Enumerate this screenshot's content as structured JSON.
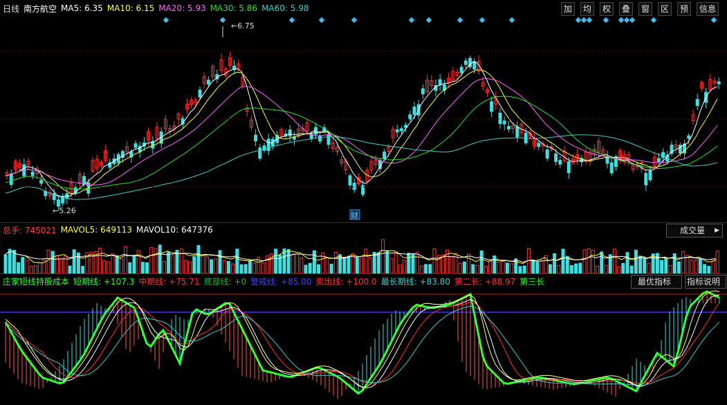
{
  "header": {
    "period": "日线",
    "stock_name": "南方航空",
    "ma": [
      {
        "label": "MA5: 6.35",
        "color": "#ffffff"
      },
      {
        "label": "MA10: 6.15",
        "color": "#ffff44"
      },
      {
        "label": "MA20: 5.93",
        "color": "#ff66ff"
      },
      {
        "label": "MA30: 5.86",
        "color": "#33dd33"
      },
      {
        "label": "MA60: 5.98",
        "color": "#44cccc"
      }
    ],
    "tools": [
      "加",
      "均",
      "权",
      "叠",
      "窗",
      "区",
      "预",
      "信息"
    ]
  },
  "price_chart": {
    "high_label": "6.75",
    "low_label": "5.26",
    "fin_marker": "财"
  },
  "volume": {
    "total": {
      "label": "总手: 745021",
      "color": "#ff4444"
    },
    "mavol5": {
      "label": "MAVOL5: 649113",
      "color": "#ffff44"
    },
    "mavol10": {
      "label": "MAVOL10: 647376",
      "color": "#ffffff"
    },
    "button": "成交量"
  },
  "indicator": {
    "name": {
      "label": "庄家短线持股成本",
      "color": "#33ff33"
    },
    "lines": [
      {
        "label": "短期线: +107.3",
        "color": "#33ff33"
      },
      {
        "label": "中期线: +75.71",
        "color": "#ff3333"
      },
      {
        "label": "底部线: +0",
        "color": "#33aa33"
      },
      {
        "label": "警戒线: +85.00",
        "color": "#4444ff"
      },
      {
        "label": "卖出线: +100.0",
        "color": "#ff3333"
      },
      {
        "label": "最长期线: +83.80",
        "color": "#44cccc"
      },
      {
        "label": "第二长: +88.97",
        "color": "#ff3333"
      },
      {
        "label": "第三长",
        "color": "#33ff33"
      }
    ],
    "best_button": "最优指标",
    "explain_button": "指标说明"
  }
}
